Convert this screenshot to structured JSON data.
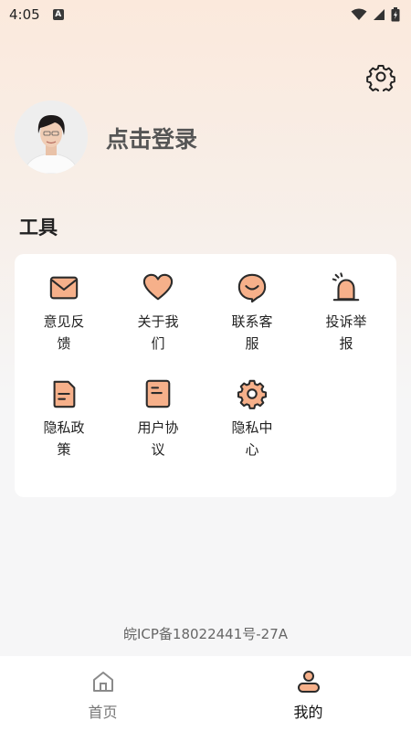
{
  "status_bar": {
    "time": "4:05",
    "notification_glyph": "A",
    "icons": [
      "wifi-icon",
      "signal-icon",
      "battery-icon"
    ]
  },
  "header": {
    "settings_icon": "gear-icon",
    "login_text": "点击登录"
  },
  "tools": {
    "title": "工具",
    "items": [
      {
        "label": "意见反馈",
        "icon": "mail-icon"
      },
      {
        "label": "关于我们",
        "icon": "heart-icon"
      },
      {
        "label": "联系客服",
        "icon": "smile-chat-icon"
      },
      {
        "label": "投诉举报",
        "icon": "alarm-icon"
      },
      {
        "label": "隐私政策",
        "icon": "document-icon"
      },
      {
        "label": "用户协议",
        "icon": "note-icon"
      },
      {
        "label": "隐私中心",
        "icon": "gear-icon"
      }
    ]
  },
  "footer": {
    "icp": "皖ICP备18022441号-27A"
  },
  "bottom_nav": {
    "items": [
      {
        "label": "首页",
        "icon": "home-icon",
        "active": false
      },
      {
        "label": "我的",
        "icon": "user-icon",
        "active": true
      }
    ]
  },
  "colors": {
    "accent": "#f6b08a",
    "stroke": "#2b2b2b"
  }
}
